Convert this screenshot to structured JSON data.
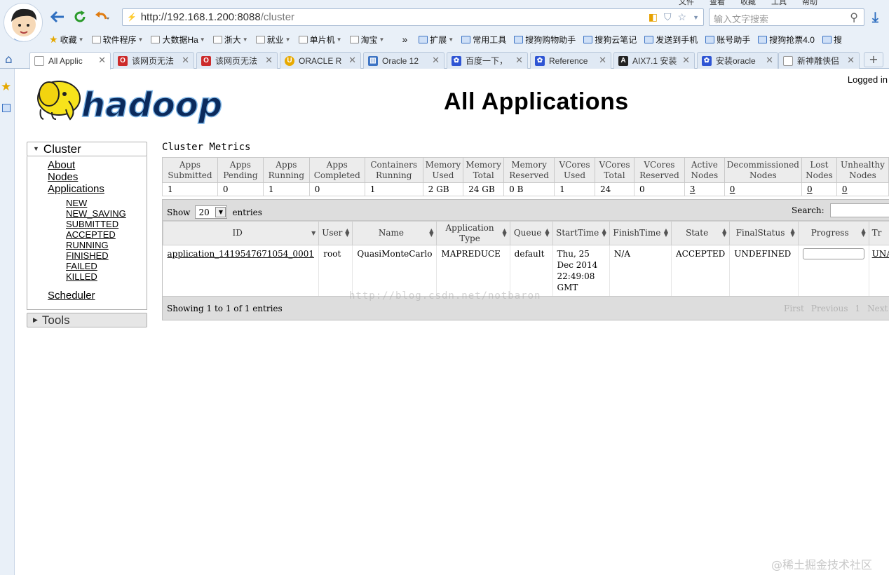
{
  "browser": {
    "menubar": [
      "文件",
      "查看",
      "收藏",
      "工具",
      "帮助"
    ],
    "address_protocol": "⚡",
    "address_host": "http://192.168.1.200:8088",
    "address_path": "/cluster",
    "search_placeholder": "输入文字搜索",
    "bookmarks": [
      {
        "label": "收藏",
        "icon": "star-icon",
        "caret": true
      },
      {
        "label": "软件程序",
        "icon": "folder-icon",
        "caret": true
      },
      {
        "label": "大数据Ha",
        "icon": "folder-icon",
        "caret": true
      },
      {
        "label": "浙大",
        "icon": "folder-icon",
        "caret": true
      },
      {
        "label": "就业",
        "icon": "folder-icon",
        "caret": true
      },
      {
        "label": "单片机",
        "icon": "folder-icon",
        "caret": true
      },
      {
        "label": "淘宝",
        "icon": "folder-icon",
        "caret": true
      }
    ],
    "bookmarks_more": "»",
    "tools": [
      {
        "label": "扩展",
        "caret": true
      },
      {
        "label": "常用工具",
        "caret": false
      },
      {
        "label": "搜狗购物助手",
        "caret": false
      },
      {
        "label": "搜狗云笔记",
        "caret": false
      },
      {
        "label": "发送到手机",
        "caret": false
      },
      {
        "label": "账号助手",
        "caret": false
      },
      {
        "label": "搜狗抢票4.0",
        "caret": false
      },
      {
        "label": "搜",
        "caret": false
      }
    ],
    "tabs": [
      {
        "label": "All Applic",
        "color": "#ffffff",
        "glyph": "",
        "active": true
      },
      {
        "label": "该网页无法",
        "color": "#cc2b2b",
        "glyph": "O"
      },
      {
        "label": "该网页无法",
        "color": "#cc2b2b",
        "glyph": "O"
      },
      {
        "label": "ORACLE R",
        "color": "#e8a900",
        "glyph": "U"
      },
      {
        "label": "Oracle 12",
        "color": "#3d74c4",
        "glyph": "▥"
      },
      {
        "label": "百度一下，",
        "color": "#2f55d4",
        "glyph": "✿"
      },
      {
        "label": "Reference",
        "color": "#2f55d4",
        "glyph": "✿"
      },
      {
        "label": "AIX7.1 安装",
        "color": "#222222",
        "glyph": "A"
      },
      {
        "label": "安装oracle",
        "color": "#2f55d4",
        "glyph": "✿"
      },
      {
        "label": "新神雕侠侣",
        "color": "#ffffff",
        "glyph": ""
      }
    ],
    "tab_new": "+"
  },
  "page": {
    "logged_in": "Logged in",
    "logo_text": "hadoop",
    "title": "All Applications",
    "nav": {
      "cluster_label": "Cluster",
      "about": "About",
      "nodes": "Nodes",
      "applications": "Applications",
      "states": [
        "NEW",
        "NEW_SAVING",
        "SUBMITTED",
        "ACCEPTED",
        "RUNNING",
        "FINISHED",
        "FAILED",
        "KILLED"
      ],
      "scheduler": "Scheduler",
      "tools_label": "Tools"
    },
    "metrics_caption": "Cluster Metrics",
    "metrics_headers": [
      [
        "Apps",
        "Submitted"
      ],
      [
        "Apps",
        "Pending"
      ],
      [
        "Apps",
        "Running"
      ],
      [
        "Apps",
        "Completed"
      ],
      [
        "Containers",
        "Running"
      ],
      [
        "Memory",
        "Used"
      ],
      [
        "Memory",
        "Total"
      ],
      [
        "Memory",
        "Reserved"
      ],
      [
        "VCores",
        "Used"
      ],
      [
        "VCores",
        "Total"
      ],
      [
        "VCores",
        "Reserved"
      ],
      [
        "Active",
        "Nodes"
      ],
      [
        "Decommissioned",
        "Nodes"
      ],
      [
        "Lost",
        "Nodes"
      ],
      [
        "Unhealthy",
        "Nodes"
      ]
    ],
    "metrics_values": [
      "1",
      "0",
      "1",
      "0",
      "1",
      "2 GB",
      "24 GB",
      "0 B",
      "1",
      "24",
      "0",
      "3",
      "0",
      "0",
      "0"
    ],
    "metrics_linked": [
      false,
      false,
      false,
      false,
      false,
      false,
      false,
      false,
      false,
      false,
      false,
      true,
      true,
      true,
      true
    ],
    "show_label": "Show",
    "page_size": "20",
    "entries_label": "entries",
    "search_label": "Search:",
    "app_headers": [
      [
        "ID"
      ],
      [
        "User"
      ],
      [
        "Name"
      ],
      [
        "Application",
        "Type"
      ],
      [
        "Queue"
      ],
      [
        "StartTime"
      ],
      [
        "FinishTime"
      ],
      [
        "State"
      ],
      [
        "FinalStatus"
      ],
      [
        "Progress"
      ],
      [
        "Tr"
      ]
    ],
    "app_row": {
      "id": "application_1419547671054_0001",
      "user": "root",
      "name": "QuasiMonteCarlo",
      "type": "MAPREDUCE",
      "queue": "default",
      "start_time": "Thu, 25 Dec 2014 22:49:08 GMT",
      "finish_time": "N/A",
      "state": "ACCEPTED",
      "final_status": "UNDEFINED",
      "progress": 0,
      "tracking": "UNA"
    },
    "showing_text": "Showing 1 to 1 of 1 entries",
    "pager": [
      "First",
      "Previous",
      "1",
      "Next"
    ],
    "watermark_blog": "http://blog.csdn.net/notbaron",
    "watermark_site": "@稀土掘金技术社区"
  }
}
